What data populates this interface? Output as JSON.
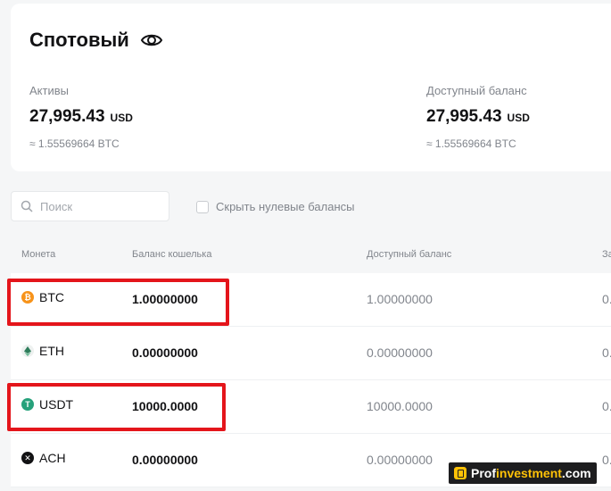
{
  "header": {
    "title": "Спотовый",
    "assets_label": "Активы",
    "assets_value": "27,995.43",
    "assets_unit": "USD",
    "assets_btc": "≈ 1.55569664 BTC",
    "available_label": "Доступный баланс",
    "available_value": "27,995.43",
    "available_unit": "USD",
    "available_btc": "≈ 1.55569664 BTC"
  },
  "filters": {
    "search_placeholder": "Поиск",
    "search_value": "",
    "hide_zero_label": "Скрыть нулевые балансы",
    "hide_zero_checked": false
  },
  "table": {
    "columns": [
      "Монета",
      "Баланс кошелька",
      "Доступный баланс",
      "За"
    ],
    "rows": [
      {
        "coin": "BTC",
        "icon": "bitcoin-icon",
        "wallet": "1.00000000",
        "available": "1.00000000",
        "extra": "0."
      },
      {
        "coin": "ETH",
        "icon": "ethereum-icon",
        "wallet": "0.00000000",
        "available": "0.00000000",
        "extra": "0."
      },
      {
        "coin": "USDT",
        "icon": "tether-icon",
        "wallet": "10000.0000",
        "available": "10000.0000",
        "extra": "0."
      },
      {
        "coin": "ACH",
        "icon": "alchemy-pay-icon",
        "wallet": "0.00000000",
        "available": "0.00000000",
        "extra": "0."
      }
    ]
  },
  "watermark": {
    "part1": "Prof",
    "part2": "investment",
    "part3": ".com"
  },
  "colors": {
    "highlight": "#e4151b",
    "btc": "#f7931a",
    "usdt": "#26a17b",
    "eth": "#dfe9e4",
    "ach": "#121214"
  }
}
